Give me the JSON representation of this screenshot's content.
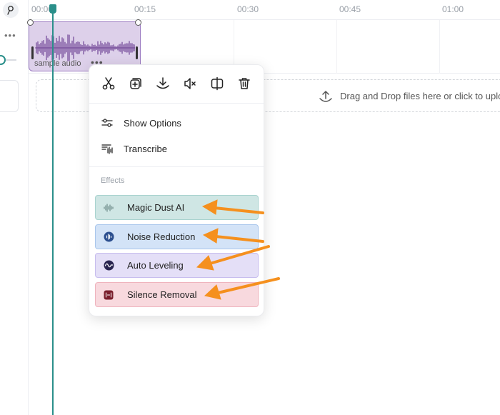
{
  "ruler": {
    "ticks": [
      "00:00",
      "00:15",
      "00:30",
      "00:45",
      "01:00"
    ]
  },
  "track": {
    "more_label": "•••",
    "clip": {
      "name": "sample audio",
      "more_label": "•••"
    }
  },
  "drop_zone": {
    "text": "Drag and Drop files here or click to upload"
  },
  "context_menu": {
    "toolbar": [
      {
        "icon": "scissors-icon",
        "action": "split"
      },
      {
        "icon": "duplicate-icon",
        "action": "duplicate"
      },
      {
        "icon": "download-icon",
        "action": "download"
      },
      {
        "icon": "mute-icon",
        "action": "mute"
      },
      {
        "icon": "split-view-icon",
        "action": "detach"
      },
      {
        "icon": "trash-icon",
        "action": "delete"
      }
    ],
    "items": [
      {
        "label": "Show Options",
        "icon": "sliders-icon"
      },
      {
        "label": "Transcribe",
        "icon": "transcribe-icon"
      }
    ],
    "effects_title": "Effects",
    "effects": [
      {
        "label": "Magic Dust AI",
        "icon": "waveform-sparkle-icon",
        "bg": "#cfe6e4",
        "border": "#a9d3cf",
        "iconColor": "#6f8c8a"
      },
      {
        "label": "Noise Reduction",
        "icon": "noise-reduction-icon",
        "bg": "#d3e3f7",
        "border": "#a9c6ec",
        "iconColor": "#2c4f8f"
      },
      {
        "label": "Auto Leveling",
        "icon": "auto-leveling-icon",
        "bg": "#e4dff7",
        "border": "#c7bdee",
        "iconColor": "#2a2550"
      },
      {
        "label": "Silence Removal",
        "icon": "silence-removal-icon",
        "bg": "#f8d9de",
        "border": "#efb3bd",
        "iconColor": "#7a1e2c"
      }
    ]
  },
  "colors": {
    "accent": "#2a8f8a",
    "clip_bg": "#ddd0ea",
    "waveform": "#5b2a86",
    "arrow": "#f5901e"
  }
}
